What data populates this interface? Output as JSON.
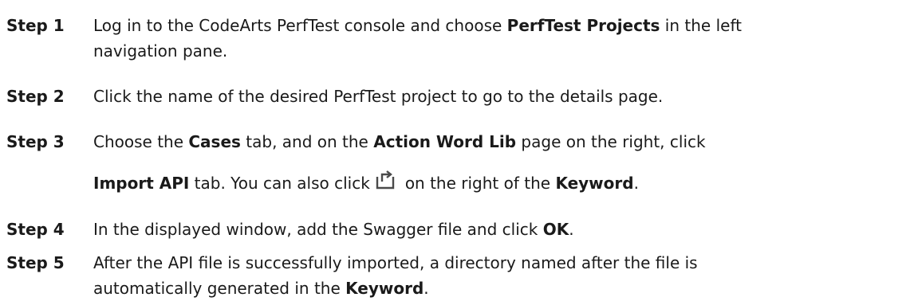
{
  "steps": [
    {
      "number": "Step 1",
      "lines": [
        [
          {
            "text": "Log in to the CodeArts PerfTest console and choose ",
            "bold": false
          },
          {
            "text": "PerfTest Projects",
            "bold": true
          },
          {
            "text": " in the left",
            "bold": false
          }
        ],
        [
          {
            "text": "navigation pane.",
            "bold": false
          }
        ]
      ]
    },
    {
      "number": "Step 2",
      "lines": [
        [
          {
            "text": "Click the name of the desired PerfTest project to go to the details page.",
            "bold": false
          }
        ]
      ]
    },
    {
      "number": "Step 3",
      "lines": [
        [
          {
            "text": "Choose the ",
            "bold": false
          },
          {
            "text": "Cases",
            "bold": true
          },
          {
            "text": " tab, and on the ",
            "bold": false
          },
          {
            "text": "Action Word Lib",
            "bold": true
          },
          {
            "text": " page on the right, click",
            "bold": false
          }
        ],
        [
          {
            "text": "Import API",
            "bold": true
          },
          {
            "text": " tab. You can also click",
            "bold": false
          },
          {
            "icon": "import-icon"
          },
          {
            "text": "on the right of the ",
            "bold": false
          },
          {
            "text": "Keyword",
            "bold": true
          },
          {
            "text": ".",
            "bold": false
          }
        ]
      ]
    },
    {
      "number": "Step 4",
      "lines": [
        [
          {
            "text": "In the displayed window, add the Swagger file and click ",
            "bold": false
          },
          {
            "text": "OK",
            "bold": true
          },
          {
            "text": ".",
            "bold": false
          }
        ]
      ]
    },
    {
      "number": "Step 5",
      "lines": [
        [
          {
            "text": "After the API file is successfully imported, a directory named after the file is",
            "bold": false
          }
        ],
        [
          {
            "text": "automatically generated in the ",
            "bold": false
          },
          {
            "text": "Keyword",
            "bold": true
          },
          {
            "text": ".",
            "bold": false
          }
        ]
      ]
    }
  ],
  "colors": {
    "text": "#1a1a1a",
    "icon": "#4a4a4a"
  }
}
